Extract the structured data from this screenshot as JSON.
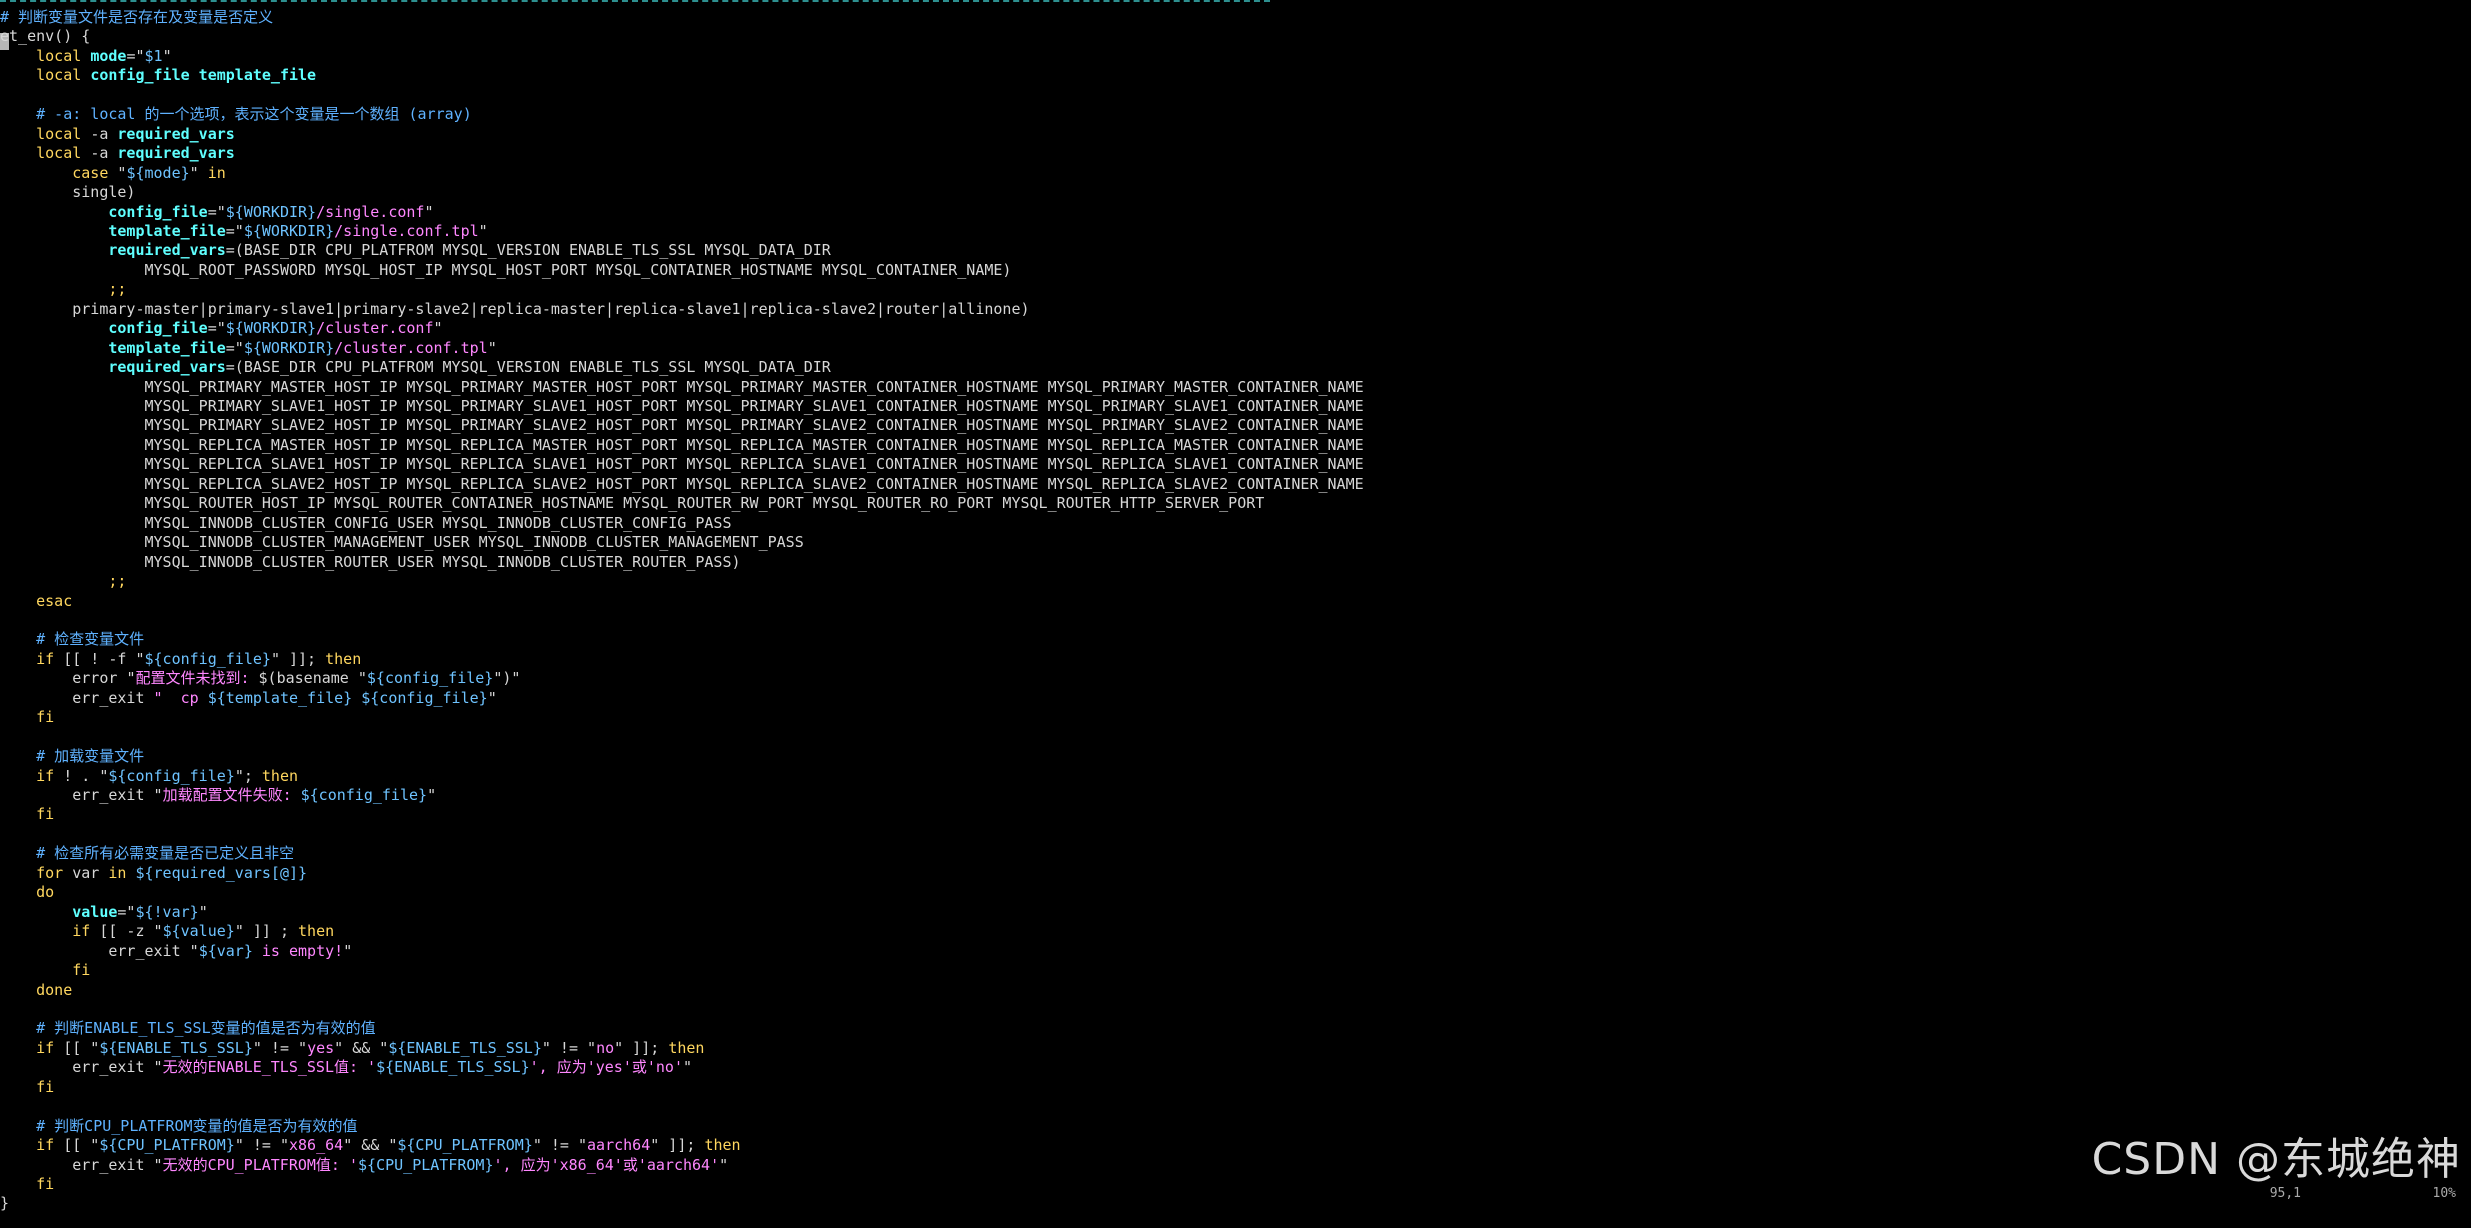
{
  "editor": {
    "lines": [
      [
        [
          "# 判断变量文件是否存在及变量是否定义",
          "cmt"
        ]
      ],
      [
        [
          "et_env() {",
          "plain"
        ]
      ],
      [
        [
          "    local ",
          "kw"
        ],
        [
          "mode",
          "key"
        ],
        [
          "=\"",
          "op"
        ],
        [
          "$1",
          "var"
        ],
        [
          "\"",
          "op"
        ]
      ],
      [
        [
          "    local ",
          "kw"
        ],
        [
          "config_file template_file",
          "key"
        ]
      ],
      [
        [
          "",
          "plain"
        ]
      ],
      [
        [
          "    # -a: local 的一个选项，表示这个变量是一个数组 (array)",
          "cmt"
        ]
      ],
      [
        [
          "    local ",
          "kw"
        ],
        [
          "-a ",
          "plain"
        ],
        [
          "required_vars",
          "key"
        ]
      ],
      [
        [
          "    local ",
          "kw"
        ],
        [
          "-a ",
          "plain"
        ],
        [
          "required_vars",
          "key"
        ]
      ],
      [
        [
          "        case ",
          "kw"
        ],
        [
          "\"",
          "op"
        ],
        [
          "${mode}",
          "var"
        ],
        [
          "\" ",
          "op"
        ],
        [
          "in",
          "kw"
        ]
      ],
      [
        [
          "        single)",
          "plain"
        ]
      ],
      [
        [
          "            config_file",
          "key"
        ],
        [
          "=\"",
          "op"
        ],
        [
          "${WORKDIR}",
          "var"
        ],
        [
          "/single.conf",
          "str"
        ],
        [
          "\"",
          "op"
        ]
      ],
      [
        [
          "            template_file",
          "key"
        ],
        [
          "=\"",
          "op"
        ],
        [
          "${WORKDIR}",
          "var"
        ],
        [
          "/single.conf.tpl",
          "str"
        ],
        [
          "\"",
          "op"
        ]
      ],
      [
        [
          "            required_vars",
          "key"
        ],
        [
          "=(BASE_DIR CPU_PLATFROM MYSQL_VERSION ENABLE_TLS_SSL MYSQL_DATA_DIR",
          "plain"
        ]
      ],
      [
        [
          "                MYSQL_ROOT_PASSWORD MYSQL_HOST_IP MYSQL_HOST_PORT MYSQL_CONTAINER_HOSTNAME MYSQL_CONTAINER_NAME)",
          "plain"
        ]
      ],
      [
        [
          "            ;;",
          "kw"
        ]
      ],
      [
        [
          "        primary-master|primary-slave1|primary-slave2|replica-master|replica-slave1|replica-slave2|router|allinone)",
          "plain"
        ]
      ],
      [
        [
          "            config_file",
          "key"
        ],
        [
          "=\"",
          "op"
        ],
        [
          "${WORKDIR}",
          "var"
        ],
        [
          "/cluster.conf",
          "str"
        ],
        [
          "\"",
          "op"
        ]
      ],
      [
        [
          "            template_file",
          "key"
        ],
        [
          "=\"",
          "op"
        ],
        [
          "${WORKDIR}",
          "var"
        ],
        [
          "/cluster.conf.tpl",
          "str"
        ],
        [
          "\"",
          "op"
        ]
      ],
      [
        [
          "            required_vars",
          "key"
        ],
        [
          "=(BASE_DIR CPU_PLATFROM MYSQL_VERSION ENABLE_TLS_SSL MYSQL_DATA_DIR",
          "plain"
        ]
      ],
      [
        [
          "                MYSQL_PRIMARY_MASTER_HOST_IP MYSQL_PRIMARY_MASTER_HOST_PORT MYSQL_PRIMARY_MASTER_CONTAINER_HOSTNAME MYSQL_PRIMARY_MASTER_CONTAINER_NAME",
          "plain"
        ]
      ],
      [
        [
          "                MYSQL_PRIMARY_SLAVE1_HOST_IP MYSQL_PRIMARY_SLAVE1_HOST_PORT MYSQL_PRIMARY_SLAVE1_CONTAINER_HOSTNAME MYSQL_PRIMARY_SLAVE1_CONTAINER_NAME",
          "plain"
        ]
      ],
      [
        [
          "                MYSQL_PRIMARY_SLAVE2_HOST_IP MYSQL_PRIMARY_SLAVE2_HOST_PORT MYSQL_PRIMARY_SLAVE2_CONTAINER_HOSTNAME MYSQL_PRIMARY_SLAVE2_CONTAINER_NAME",
          "plain"
        ]
      ],
      [
        [
          "                MYSQL_REPLICA_MASTER_HOST_IP MYSQL_REPLICA_MASTER_HOST_PORT MYSQL_REPLICA_MASTER_CONTAINER_HOSTNAME MYSQL_REPLICA_MASTER_CONTAINER_NAME",
          "plain"
        ]
      ],
      [
        [
          "                MYSQL_REPLICA_SLAVE1_HOST_IP MYSQL_REPLICA_SLAVE1_HOST_PORT MYSQL_REPLICA_SLAVE1_CONTAINER_HOSTNAME MYSQL_REPLICA_SLAVE1_CONTAINER_NAME",
          "plain"
        ]
      ],
      [
        [
          "                MYSQL_REPLICA_SLAVE2_HOST_IP MYSQL_REPLICA_SLAVE2_HOST_PORT MYSQL_REPLICA_SLAVE2_CONTAINER_HOSTNAME MYSQL_REPLICA_SLAVE2_CONTAINER_NAME",
          "plain"
        ]
      ],
      [
        [
          "                MYSQL_ROUTER_HOST_IP MYSQL_ROUTER_CONTAINER_HOSTNAME MYSQL_ROUTER_RW_PORT MYSQL_ROUTER_RO_PORT MYSQL_ROUTER_HTTP_SERVER_PORT",
          "plain"
        ]
      ],
      [
        [
          "                MYSQL_INNODB_CLUSTER_CONFIG_USER MYSQL_INNODB_CLUSTER_CONFIG_PASS",
          "plain"
        ]
      ],
      [
        [
          "                MYSQL_INNODB_CLUSTER_MANAGEMENT_USER MYSQL_INNODB_CLUSTER_MANAGEMENT_PASS",
          "plain"
        ]
      ],
      [
        [
          "                MYSQL_INNODB_CLUSTER_ROUTER_USER MYSQL_INNODB_CLUSTER_ROUTER_PASS)",
          "plain"
        ]
      ],
      [
        [
          "            ;;",
          "kw"
        ]
      ],
      [
        [
          "    esac",
          "kw"
        ]
      ],
      [
        [
          "",
          "plain"
        ]
      ],
      [
        [
          "    # 检查变量文件",
          "cmt"
        ]
      ],
      [
        [
          "    if ",
          "kw"
        ],
        [
          "[[ ! -f \"",
          "op"
        ],
        [
          "${config_file}",
          "var"
        ],
        [
          "\" ]]; ",
          "op"
        ],
        [
          "then",
          "kw"
        ]
      ],
      [
        [
          "        error ",
          "plain"
        ],
        [
          "\"",
          "op"
        ],
        [
          "配置文件未找到: ",
          "str"
        ],
        [
          "$(basename \"",
          "op"
        ],
        [
          "${config_file}",
          "var"
        ],
        [
          "\")\"",
          "op"
        ]
      ],
      [
        [
          "        err_exit ",
          "plain"
        ],
        [
          "\"  cp ",
          "str"
        ],
        [
          "${template_file} ${config_file}",
          "var"
        ],
        [
          "\"",
          "op"
        ]
      ],
      [
        [
          "    fi",
          "kw"
        ]
      ],
      [
        [
          "",
          "plain"
        ]
      ],
      [
        [
          "    # 加载变量文件",
          "cmt"
        ]
      ],
      [
        [
          "    if ",
          "kw"
        ],
        [
          "! . \"",
          "op"
        ],
        [
          "${config_file}",
          "var"
        ],
        [
          "\"; ",
          "op"
        ],
        [
          "then",
          "kw"
        ]
      ],
      [
        [
          "        err_exit ",
          "plain"
        ],
        [
          "\"",
          "op"
        ],
        [
          "加载配置文件失败: ",
          "str"
        ],
        [
          "${config_file}",
          "var"
        ],
        [
          "\"",
          "op"
        ]
      ],
      [
        [
          "    fi",
          "kw"
        ]
      ],
      [
        [
          "",
          "plain"
        ]
      ],
      [
        [
          "    # 检查所有必需变量是否已定义且非空",
          "cmt"
        ]
      ],
      [
        [
          "    for ",
          "kw"
        ],
        [
          "var ",
          "plain"
        ],
        [
          "in ",
          "kw"
        ],
        [
          "${required_vars[@]}",
          "var"
        ]
      ],
      [
        [
          "    do",
          "kw"
        ]
      ],
      [
        [
          "        value",
          "key"
        ],
        [
          "=\"",
          "op"
        ],
        [
          "${!var}",
          "var"
        ],
        [
          "\"",
          "op"
        ]
      ],
      [
        [
          "        if ",
          "kw"
        ],
        [
          "[[ -z \"",
          "op"
        ],
        [
          "${value}",
          "var"
        ],
        [
          "\" ]] ; ",
          "op"
        ],
        [
          "then",
          "kw"
        ]
      ],
      [
        [
          "            err_exit ",
          "plain"
        ],
        [
          "\"",
          "op"
        ],
        [
          "${var}",
          "var"
        ],
        [
          " is empty!",
          "str"
        ],
        [
          "\"",
          "op"
        ]
      ],
      [
        [
          "        fi",
          "kw"
        ]
      ],
      [
        [
          "    done",
          "kw"
        ]
      ],
      [
        [
          "",
          "plain"
        ]
      ],
      [
        [
          "    # 判断ENABLE_TLS_SSL变量的值是否为有效的值",
          "cmt"
        ]
      ],
      [
        [
          "    if ",
          "kw"
        ],
        [
          "[[ \"",
          "op"
        ],
        [
          "${ENABLE_TLS_SSL}",
          "var"
        ],
        [
          "\" != \"",
          "op"
        ],
        [
          "yes",
          "str"
        ],
        [
          "\" && \"",
          "op"
        ],
        [
          "${ENABLE_TLS_SSL}",
          "var"
        ],
        [
          "\" != \"",
          "op"
        ],
        [
          "no",
          "str"
        ],
        [
          "\" ]]; ",
          "op"
        ],
        [
          "then",
          "kw"
        ]
      ],
      [
        [
          "        err_exit ",
          "plain"
        ],
        [
          "\"",
          "op"
        ],
        [
          "无效的ENABLE_TLS_SSL值: '",
          "str"
        ],
        [
          "${ENABLE_TLS_SSL}",
          "var"
        ],
        [
          "', 应为'yes'或'no'",
          "str"
        ],
        [
          "\"",
          "op"
        ]
      ],
      [
        [
          "    fi",
          "kw"
        ]
      ],
      [
        [
          "",
          "plain"
        ]
      ],
      [
        [
          "    # 判断CPU_PLATFROM变量的值是否为有效的值",
          "cmt"
        ]
      ],
      [
        [
          "    if ",
          "kw"
        ],
        [
          "[[ \"",
          "op"
        ],
        [
          "${CPU_PLATFROM}",
          "var"
        ],
        [
          "\" != \"",
          "op"
        ],
        [
          "x86_64",
          "str"
        ],
        [
          "\" && \"",
          "op"
        ],
        [
          "${CPU_PLATFROM}",
          "var"
        ],
        [
          "\" != \"",
          "op"
        ],
        [
          "aarch64",
          "str"
        ],
        [
          "\" ]]; ",
          "op"
        ],
        [
          "then",
          "kw"
        ]
      ],
      [
        [
          "        err_exit ",
          "plain"
        ],
        [
          "\"",
          "op"
        ],
        [
          "无效的CPU_PLATFROM值: '",
          "str"
        ],
        [
          "${CPU_PLATFROM}",
          "var"
        ],
        [
          "', 应为'x86_64'或'aarch64'",
          "str"
        ],
        [
          "\"",
          "op"
        ]
      ],
      [
        [
          "    fi",
          "kw"
        ]
      ],
      [
        [
          "}",
          "plain"
        ]
      ]
    ]
  },
  "watermark": {
    "text": "CSDN @东城绝神"
  },
  "status": {
    "position": "95,1",
    "percent": "10%"
  }
}
